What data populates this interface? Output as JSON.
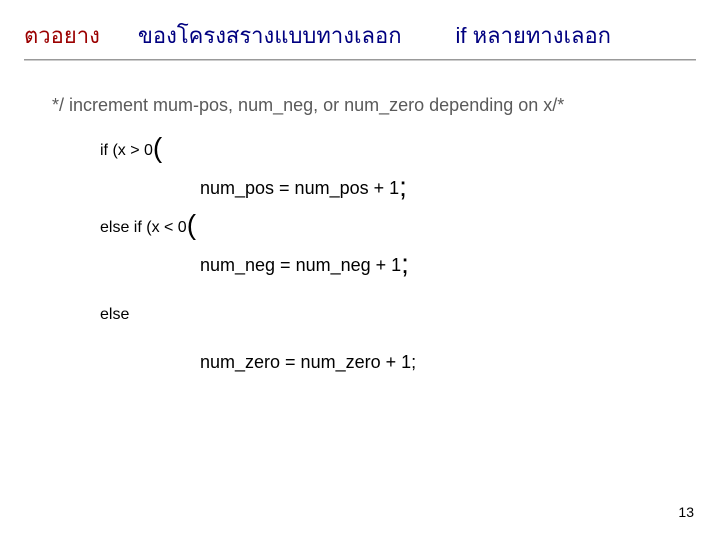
{
  "title": {
    "example": "ตวอยาง",
    "desc": "ของโครงสรางแบบทางเลอก",
    "if_text": "if หลายทางเลอก"
  },
  "comment": "*/ increment mum-pos, num_neg, or num_zero depending on x/*",
  "code": {
    "if_pre": "if (x > 0",
    "if_paren": "(",
    "body1_a": "num_pos = num_pos + 1",
    "body1_semi": ";",
    "elseif_pre": "else if (x < 0",
    "elseif_paren": "(",
    "body2_a": "num_neg = num_neg + 1",
    "body2_semi": ";",
    "else_label": "else",
    "body3": "num_zero = num_zero + 1;"
  },
  "page_number": "13"
}
